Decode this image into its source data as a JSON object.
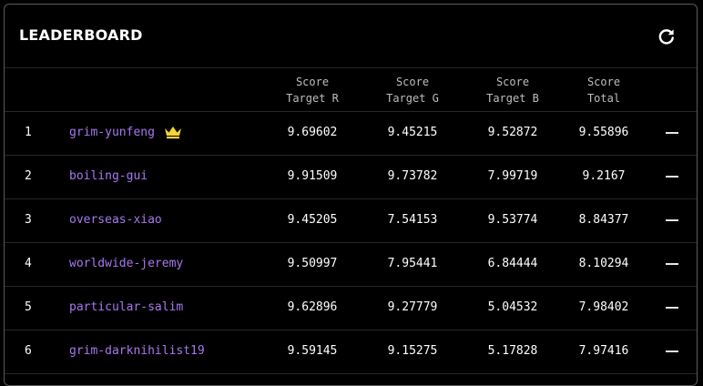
{
  "leaderboard": {
    "title": "LEADERBOARD",
    "refresh_icon": "refresh-icon",
    "columns": [
      {
        "line1": "Score",
        "line2": "Target R"
      },
      {
        "line1": "Score",
        "line2": "Target G"
      },
      {
        "line1": "Score",
        "line2": "Target B"
      },
      {
        "line1": "Score",
        "line2": "Total"
      }
    ],
    "rows": [
      {
        "rank": "1",
        "name": "grim-yunfeng",
        "r": "9.69602",
        "g": "9.45215",
        "b": "9.52872",
        "total": "9.55896",
        "crown": true
      },
      {
        "rank": "2",
        "name": "boiling-gui",
        "r": "9.91509",
        "g": "9.73782",
        "b": "7.99719",
        "total": "9.2167"
      },
      {
        "rank": "3",
        "name": "overseas-xiao",
        "r": "9.45205",
        "g": "7.54153",
        "b": "9.53774",
        "total": "8.84377"
      },
      {
        "rank": "4",
        "name": "worldwide-jeremy",
        "r": "9.50997",
        "g": "7.95441",
        "b": "6.84444",
        "total": "8.10294"
      },
      {
        "rank": "5",
        "name": "particular-salim",
        "r": "9.62896",
        "g": "9.27779",
        "b": "5.04532",
        "total": "7.98402"
      },
      {
        "rank": "6",
        "name": "grim-darknihilist19",
        "r": "9.59145",
        "g": "9.15275",
        "b": "5.17828",
        "total": "7.97416"
      }
    ],
    "colors": {
      "background": "#000000",
      "border": "#5a5a5a",
      "divider": "#262626",
      "name_link": "#a877f0",
      "crown": "#f5d33a",
      "text": "#ffffff"
    }
  }
}
